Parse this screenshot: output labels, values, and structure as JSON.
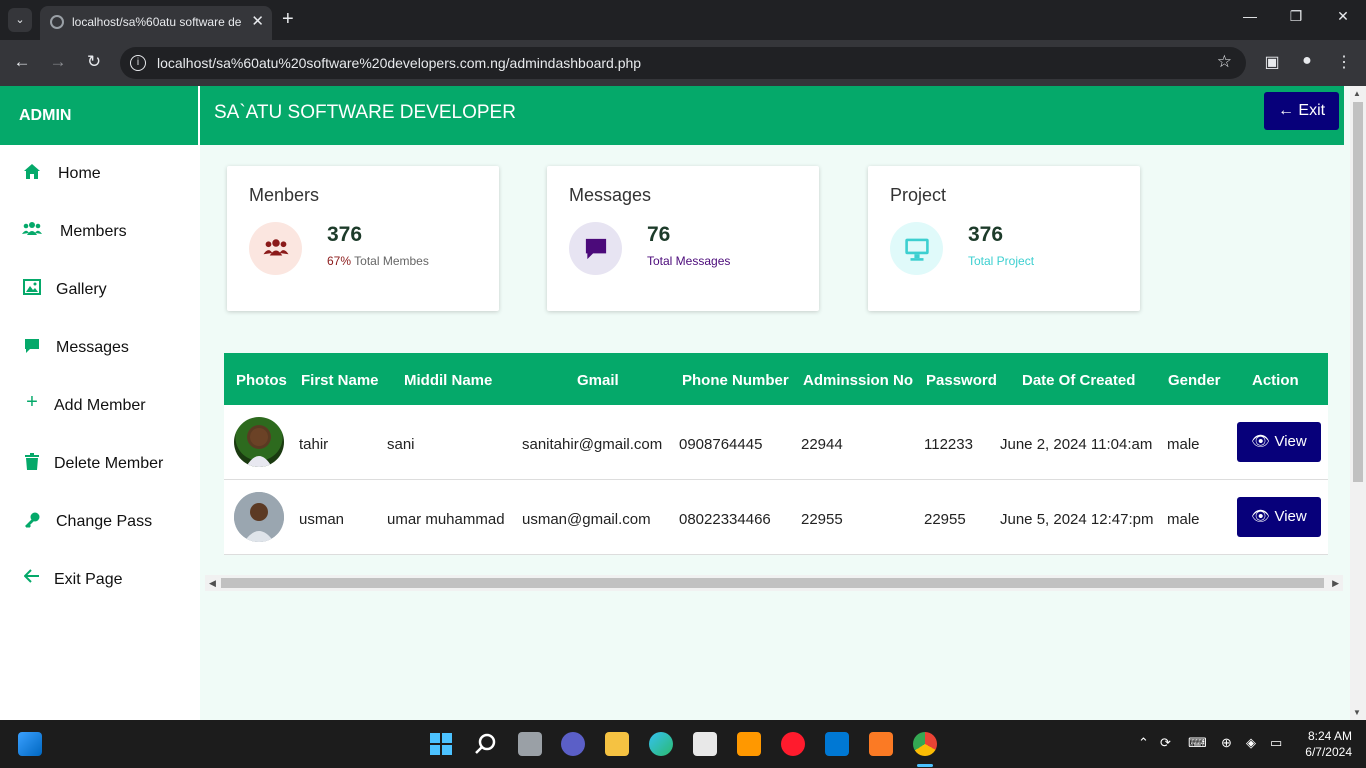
{
  "browser": {
    "tab_title": "localhost/sa%60atu software de",
    "url": "localhost/sa%60atu%20software%20developers.com.ng/admindashboard.php"
  },
  "sidebar": {
    "brand": "ADMIN",
    "items": [
      {
        "label": "Home",
        "icon": "home-icon"
      },
      {
        "label": "Members",
        "icon": "users-icon"
      },
      {
        "label": "Gallery",
        "icon": "image-icon"
      },
      {
        "label": "Messages",
        "icon": "message-icon"
      },
      {
        "label": "Add Member",
        "icon": "plus-icon"
      },
      {
        "label": "Delete Member",
        "icon": "trash-icon"
      },
      {
        "label": "Change Pass",
        "icon": "key-icon"
      },
      {
        "label": "Exit Page",
        "icon": "arrow-left-icon"
      }
    ]
  },
  "header": {
    "title": "SA`ATU SOFTWARE DEVELOPER",
    "exit_label": "Exit"
  },
  "cards": [
    {
      "title": "Menbers",
      "count": "376",
      "pct": "67%",
      "sub": "Total Membes",
      "icon": "users-icon"
    },
    {
      "title": "Messages",
      "count": "76",
      "sub": "Total Messages",
      "icon": "message-icon"
    },
    {
      "title": "Project",
      "count": "376",
      "sub": "Total Project",
      "icon": "monitor-icon"
    }
  ],
  "table": {
    "headers": [
      "Photos",
      "First Name",
      "Middil Name",
      "Gmail",
      "Phone Number",
      "Adminssion No",
      "Password",
      "Date Of Created",
      "Gender",
      "Action"
    ],
    "rows": [
      {
        "first": "tahir",
        "middle": "sani",
        "gmail": "sanitahir@gmail.com",
        "phone": "0908764445",
        "admission": "22944",
        "password": "112233",
        "created": "June 2, 2024 11:04:am",
        "gender": "male",
        "action": "View"
      },
      {
        "first": "usman",
        "middle": "umar muhammad",
        "gmail": "usman@gmail.com",
        "phone": "08022334466",
        "admission": "22955",
        "password": "22955",
        "created": "June 5, 2024 12:47:pm",
        "gender": "male",
        "action": "View"
      }
    ]
  },
  "taskbar": {
    "time": "8:24 AM",
    "date": "6/7/2024"
  },
  "colors": {
    "accent": "#05a96a",
    "button": "#07007a"
  }
}
